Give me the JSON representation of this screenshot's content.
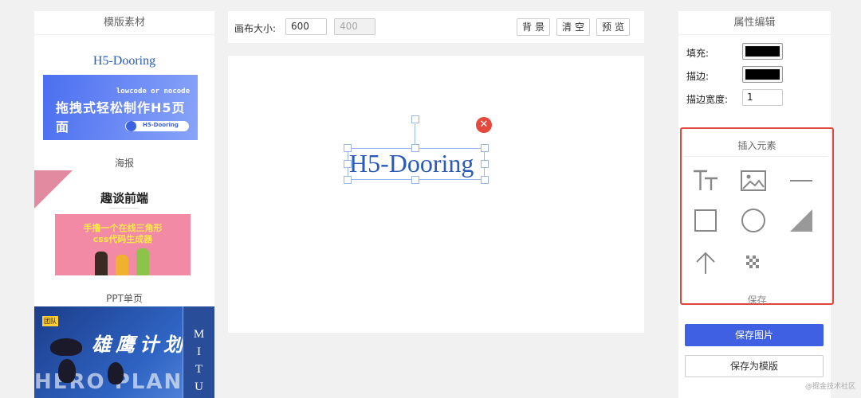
{
  "left_panel": {
    "header": "模版素材",
    "template1": {
      "title": "H5-Dooring",
      "subtitle": "lowcode or nocode",
      "headline": "拖拽式轻松制作H5页面",
      "pill_text": "H5-Dooring"
    },
    "section_poster": "海报",
    "template2": {
      "title": "趣谈前端",
      "line1": "手撸一个在线三角形",
      "line2": "css代码生成器"
    },
    "section_ppt": "PPT单页",
    "template3": {
      "tag": "团队",
      "headline": "雄鹰计划",
      "english": "HERO PLAN",
      "side_letters": [
        "M",
        "I",
        "T",
        "U"
      ]
    }
  },
  "toolbar": {
    "canvas_size_label": "画布大小:",
    "width_value": "600",
    "height_value": "400",
    "bg_button": "背景",
    "clear_button": "清空",
    "preview_button": "预览"
  },
  "canvas": {
    "text_element": "H5-Dooring",
    "text_color": "#2a5ab8"
  },
  "right_panel": {
    "header": "属性编辑",
    "fill_label": "填充:",
    "fill_color": "#000000",
    "stroke_label": "描边:",
    "stroke_color": "#000000",
    "stroke_width_label": "描边宽度:",
    "stroke_width_value": "1",
    "insert_title": "插入元素",
    "tools": [
      "text-icon",
      "image-icon",
      "line-icon",
      "rect-icon",
      "circle-icon",
      "triangle-icon",
      "arrow-up-icon",
      "mosaic-icon"
    ],
    "save_label": "保存",
    "save_image_button": "保存图片",
    "save_template_button": "保存为模版"
  },
  "watermark": "@掘金技术社区",
  "colors": {
    "primary": "#3f60e2",
    "danger": "#e5483f",
    "highlight_border": "#e0463c"
  }
}
